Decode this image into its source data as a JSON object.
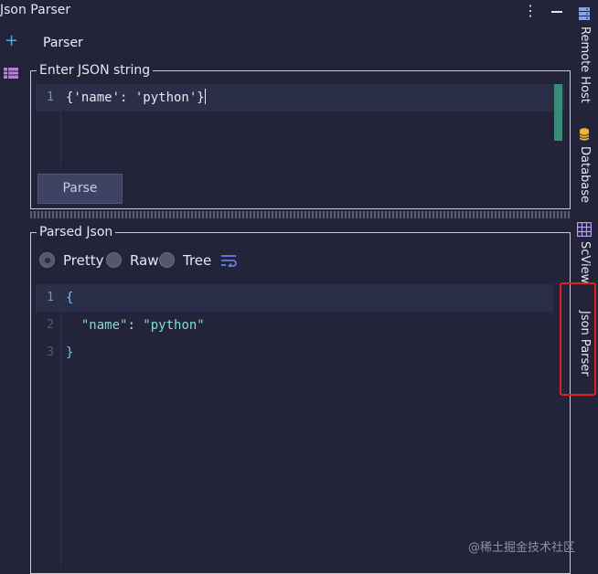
{
  "window": {
    "title": "Json Parser",
    "menu_icon": "kebab-menu-icon",
    "minimize_icon": "minimize-icon"
  },
  "left_toolbar": {
    "add_icon": "plus-icon",
    "list_icon": "list-icon",
    "tab_label": "Parser"
  },
  "input_panel": {
    "legend": "Enter JSON string",
    "lines": [
      {
        "number": "1",
        "text": "{'name': 'python'}"
      }
    ],
    "parse_button": "Parse"
  },
  "output_panel": {
    "legend": "Parsed Json",
    "view_modes": [
      {
        "label": "Pretty",
        "checked": true
      },
      {
        "label": "Raw",
        "checked": false
      },
      {
        "label": "Tree",
        "checked": false
      }
    ],
    "wrap_icon": "soft-wrap-icon",
    "lines": [
      {
        "number": "1",
        "indent": "",
        "brace": "{",
        "key": "",
        "sep": "",
        "value": ""
      },
      {
        "number": "2",
        "indent": "  ",
        "brace": "",
        "key": "\"name\"",
        "sep": ": ",
        "value": "\"python\""
      },
      {
        "number": "3",
        "indent": "",
        "brace": "}",
        "key": "",
        "sep": "",
        "value": ""
      }
    ]
  },
  "right_sidebar": {
    "items": [
      {
        "label": "Remote Host",
        "icon": "server-icon",
        "color": "#7aa7e8"
      },
      {
        "label": "Database",
        "icon": "database-icon",
        "color": "#f0b23a"
      },
      {
        "label": "ScView",
        "icon": "table-grid-icon",
        "color": "#b89ef0"
      },
      {
        "label": "Json Parser",
        "icon": "",
        "color": ""
      }
    ],
    "active": "Json Parser",
    "highlight_color": "#e02020"
  },
  "watermark": "@稀土掘金技术社区",
  "colors": {
    "background": "#23243a",
    "current_line": "#2b2e48",
    "string": "#7fe0c7",
    "brace": "#78c2f0",
    "scroll_thumb": "#3c8a78",
    "button": "#3e4263"
  }
}
